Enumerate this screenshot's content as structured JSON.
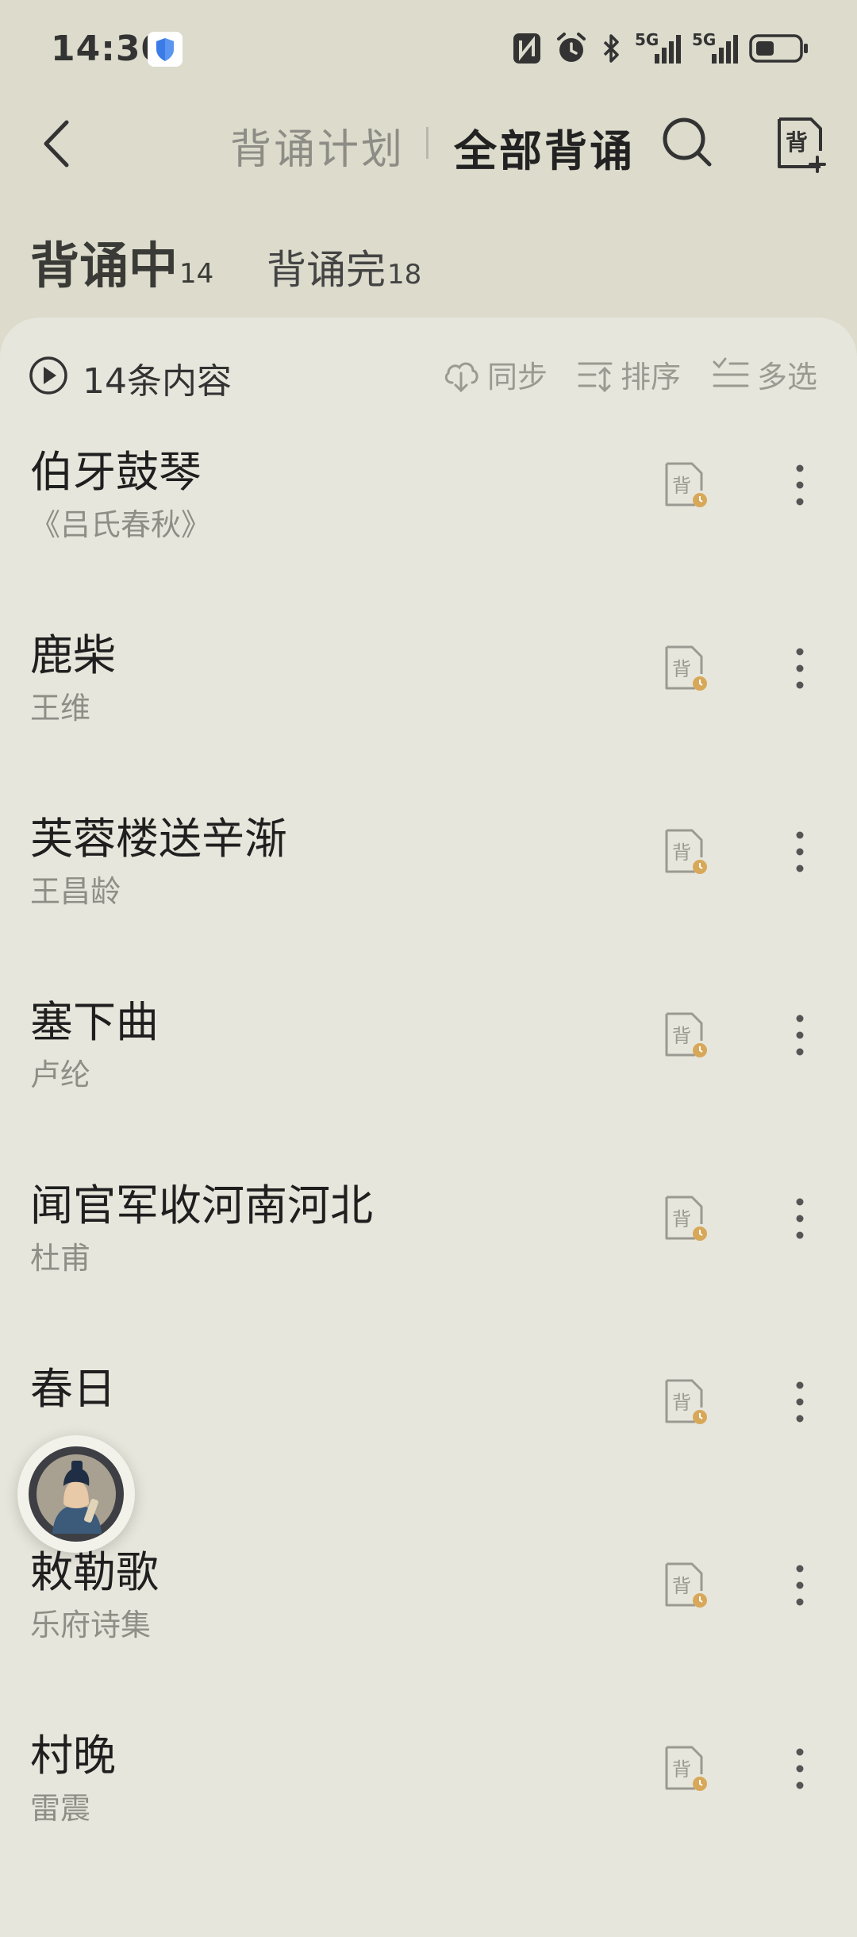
{
  "status": {
    "time": "14:30",
    "net1": "5G",
    "net2": "5G"
  },
  "header": {
    "tab_plan": "背诵计划",
    "tab_all": "全部背诵",
    "add_icon_text": "背"
  },
  "subtabs": [
    {
      "label": "背诵中",
      "count": "14"
    },
    {
      "label": "背诵完",
      "count": "18"
    }
  ],
  "toolbar": {
    "count_text": "14条内容",
    "sync": "同步",
    "sort": "排序",
    "multi": "多选"
  },
  "items": [
    {
      "title": "伯牙鼓琴",
      "sub": "《吕氏春秋》"
    },
    {
      "title": "鹿柴",
      "sub": "王维"
    },
    {
      "title": "芙蓉楼送辛渐",
      "sub": "王昌龄"
    },
    {
      "title": "塞下曲",
      "sub": "卢纶"
    },
    {
      "title": "闻官军收河南河北",
      "sub": "杜甫"
    },
    {
      "title": "春日",
      "sub": ""
    },
    {
      "title": "敕勒歌",
      "sub": "乐府诗集"
    },
    {
      "title": "村晚",
      "sub": "雷震"
    }
  ],
  "item_icon_text": "背",
  "colors": {
    "background": "#dcdbcc",
    "card": "#e7e6dc",
    "accent": "#d8a85a"
  }
}
